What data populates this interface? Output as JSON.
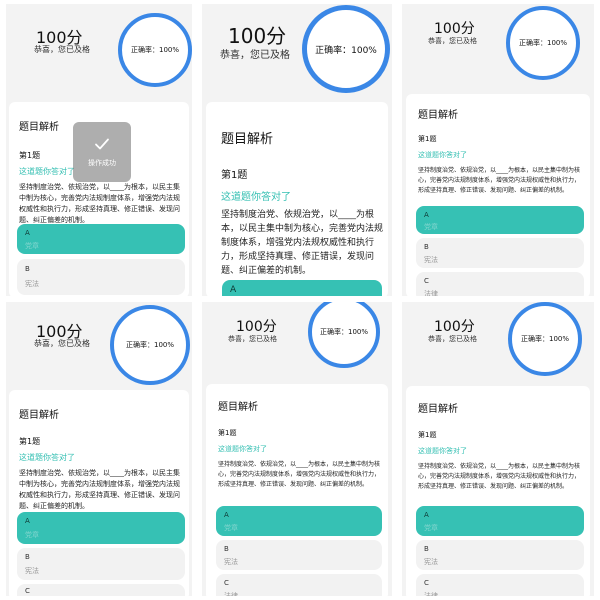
{
  "panels": [
    {
      "score": "100分",
      "subtitle": "恭喜，您已及格",
      "accuracy": "正确率：100%",
      "card_title": "题目解析",
      "question_number": "第1题",
      "correct_text": "这道题你答对了",
      "question": "坚持制度治党、依规治党，以____为根本，以民主集中制为核心，完善党内法规制度体系，增强党内法规权威性和执行力，形成坚持真理、修正错误、发现问题、纠正偏差的机制。",
      "options": [
        {
          "letter": "A",
          "text": "党章",
          "selected": true
        },
        {
          "letter": "B",
          "text": "宪法",
          "selected": false
        }
      ],
      "toast": "操作成功"
    },
    {
      "score": "100分",
      "subtitle": "恭喜，您已及格",
      "accuracy": "正确率：100%",
      "card_title": "题目解析",
      "question_number": "第1题",
      "correct_text": "这道题你答对了",
      "question": "坚持制度治党、依规治党，以____为根本，以民主集中制为核心，完善党内法规制度体系，增强党内法规权威性和执行力，形成坚持真理、修正错误，发现问题、纠正偏差的机制。",
      "options": [
        {
          "letter": "A",
          "text": "",
          "selected": true
        }
      ]
    },
    {
      "score": "100分",
      "subtitle": "恭喜，您已及格",
      "accuracy": "正确率：100%",
      "card_title": "题目解析",
      "question_number": "第1题",
      "correct_text": "这道题你答对了",
      "question": "坚持制度治党、依规治党，以____为根本，以民主集中制为核心，完善党内法规制度体系，增强党内法规权威性和执行力，形成坚持真理、修正错误、发现问题、纠正偏差的机制。",
      "options": [
        {
          "letter": "A",
          "text": "党章",
          "selected": true
        },
        {
          "letter": "B",
          "text": "宪法",
          "selected": false
        },
        {
          "letter": "C",
          "text": "法律",
          "selected": false
        }
      ]
    },
    {
      "score": "100分",
      "subtitle": "恭喜，您已及格",
      "accuracy": "正确率：100%",
      "card_title": "题目解析",
      "question_number": "第1题",
      "correct_text": "这道题你答对了",
      "question": "坚持制度治党、依规治党，以____为根本，以民主集中制为核心，完善党内法规制度体系，增强党内法规权威性和执行力，形成坚持真理、修正错误、发现问题、纠正偏差的机制。",
      "options": [
        {
          "letter": "A",
          "text": "党章",
          "selected": true
        },
        {
          "letter": "B",
          "text": "宪法",
          "selected": false
        },
        {
          "letter": "C",
          "text": "",
          "selected": false
        }
      ]
    },
    {
      "score": "100分",
      "subtitle": "恭喜，您已及格",
      "accuracy": "正确率：100%",
      "card_title": "题目解析",
      "question_number": "第1题",
      "correct_text": "这道题你答对了",
      "question": "坚持制度治党、依规治党，以____为根本，以民主集中制为核心，完善党内法规制度体系，增强党内法规权威性和执行力，形成坚持真理、修正错误、发现问题、纠正偏差的机制。",
      "options": [
        {
          "letter": "A",
          "text": "党章",
          "selected": true
        },
        {
          "letter": "B",
          "text": "宪法",
          "selected": false
        },
        {
          "letter": "C",
          "text": "法律",
          "selected": false
        }
      ]
    },
    {
      "score": "100分",
      "subtitle": "恭喜，您已及格",
      "accuracy": "正确率：100%",
      "card_title": "题目解析",
      "question_number": "第1题",
      "correct_text": "这道题你答对了",
      "question": "坚持制度治党、依规治党，以____为根本，以民主集中制为核心，完善党内法规制度体系，增强党内法规权威性和执行力，形成坚持真理、修正错误、发现问题、纠正偏差的机制。",
      "options": [
        {
          "letter": "A",
          "text": "党章",
          "selected": true
        },
        {
          "letter": "B",
          "text": "宪法",
          "selected": false
        },
        {
          "letter": "C",
          "text": "法律",
          "selected": false
        }
      ]
    }
  ],
  "colors": {
    "ring": "#3a87e6",
    "accent": "#33bfb2",
    "selected_option": "#36c1b4"
  }
}
